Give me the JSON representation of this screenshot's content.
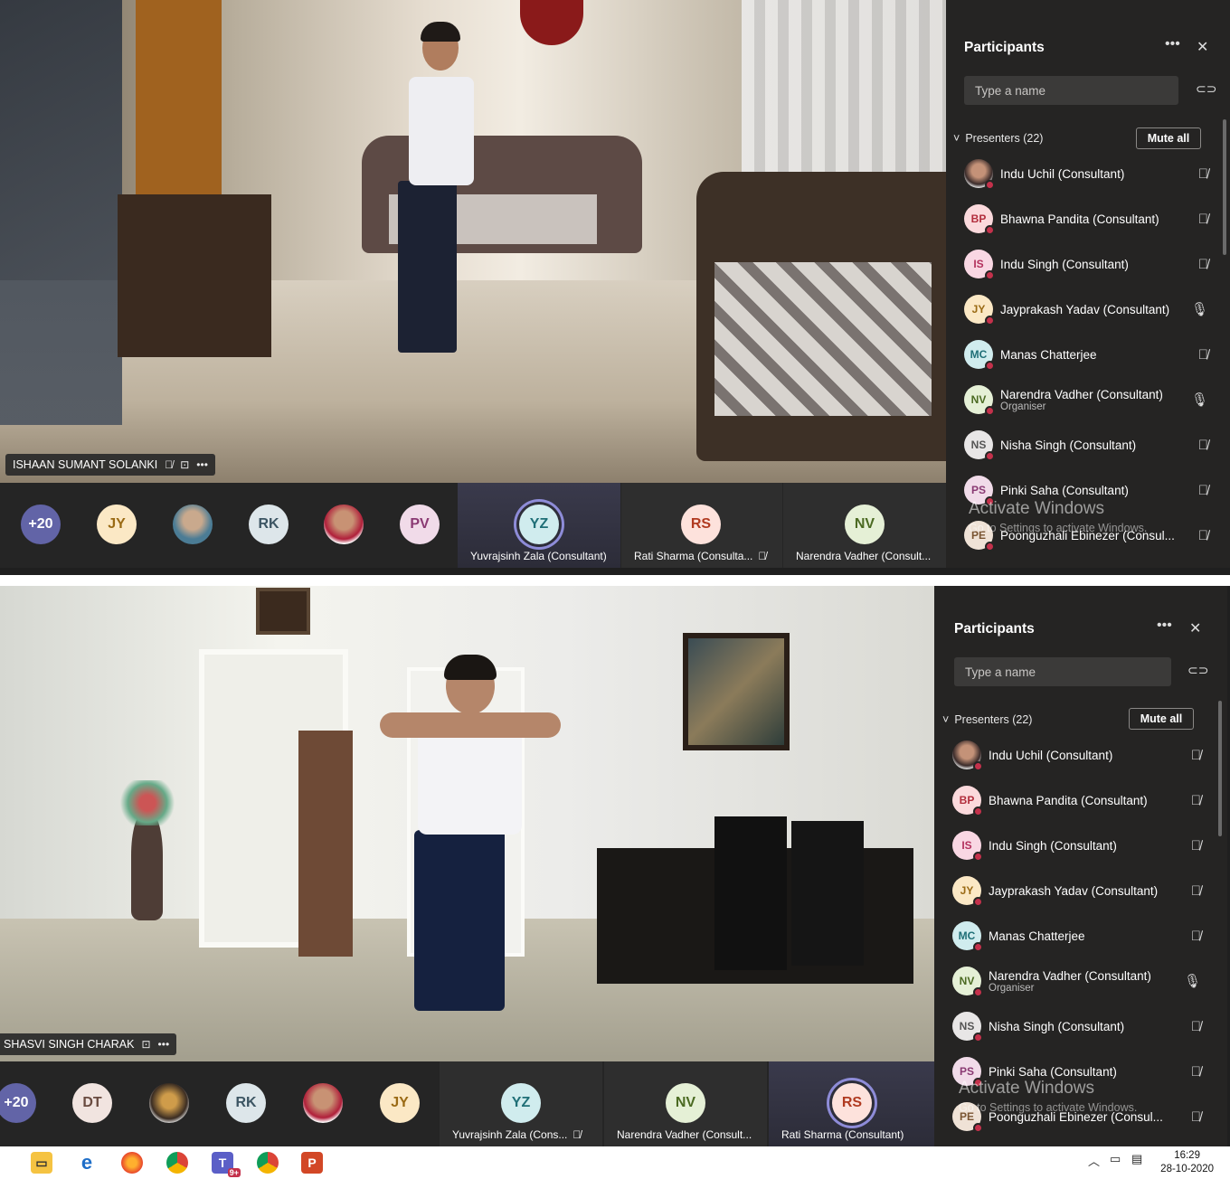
{
  "screen1": {
    "video_label": "ISHAAN SUMANT SOLANKI",
    "strip": {
      "overflow_count": "+20",
      "avatars": [
        "JY",
        "",
        "RK",
        "",
        "PV"
      ],
      "tiles": [
        {
          "initials": "YZ",
          "name": "Yuvrajsinh Zala (Consultant)"
        },
        {
          "initials": "RS",
          "name": "Rati Sharma (Consulta..."
        },
        {
          "initials": "NV",
          "name": "Narendra Vadher (Consult..."
        }
      ]
    },
    "panel": {
      "title": "Participants",
      "search_placeholder": "Type a name",
      "section": "Presenters (22)",
      "mute_all": "Mute all",
      "participants": [
        {
          "initials": "",
          "name": "Indu Uchil (Consultant)",
          "role": "",
          "mic": "muted"
        },
        {
          "initials": "BP",
          "name": "Bhawna Pandita (Consultant)",
          "role": "",
          "mic": "muted"
        },
        {
          "initials": "IS",
          "name": "Indu Singh (Consultant)",
          "role": "",
          "mic": "muted"
        },
        {
          "initials": "JY",
          "name": "Jayprakash Yadav (Consultant)",
          "role": "",
          "mic": "on"
        },
        {
          "initials": "MC",
          "name": "Manas Chatterjee",
          "role": "",
          "mic": "muted"
        },
        {
          "initials": "NV",
          "name": "Narendra Vadher (Consultant)",
          "role": "Organiser",
          "mic": "on"
        },
        {
          "initials": "NS",
          "name": "Nisha Singh (Consultant)",
          "role": "",
          "mic": "muted"
        },
        {
          "initials": "PS",
          "name": "Pinki Saha (Consultant)",
          "role": "",
          "mic": "muted"
        },
        {
          "initials": "PE",
          "name": "Poonguzhali Ebinezer (Consul...",
          "role": "",
          "mic": "muted"
        }
      ]
    }
  },
  "screen2": {
    "video_label": "SHASVI SINGH CHARAK",
    "strip": {
      "overflow_count": "+20",
      "avatars": [
        "DT",
        "",
        "RK",
        "",
        "JY"
      ],
      "tiles": [
        {
          "initials": "YZ",
          "name": "Yuvrajsinh Zala (Cons..."
        },
        {
          "initials": "NV",
          "name": "Narendra Vadher (Consult..."
        },
        {
          "initials": "RS",
          "name": "Rati Sharma (Consultant)"
        }
      ]
    },
    "panel": {
      "title": "Participants",
      "search_placeholder": "Type a name",
      "section": "Presenters (22)",
      "mute_all": "Mute all",
      "participants": [
        {
          "initials": "",
          "name": "Indu Uchil (Consultant)",
          "role": "",
          "mic": "muted"
        },
        {
          "initials": "BP",
          "name": "Bhawna Pandita (Consultant)",
          "role": "",
          "mic": "muted"
        },
        {
          "initials": "IS",
          "name": "Indu Singh (Consultant)",
          "role": "",
          "mic": "muted"
        },
        {
          "initials": "JY",
          "name": "Jayprakash Yadav (Consultant)",
          "role": "",
          "mic": "muted"
        },
        {
          "initials": "MC",
          "name": "Manas Chatterjee",
          "role": "",
          "mic": "muted"
        },
        {
          "initials": "NV",
          "name": "Narendra Vadher (Consultant)",
          "role": "Organiser",
          "mic": "on"
        },
        {
          "initials": "NS",
          "name": "Nisha Singh (Consultant)",
          "role": "",
          "mic": "muted"
        },
        {
          "initials": "PS",
          "name": "Pinki Saha (Consultant)",
          "role": "",
          "mic": "muted"
        },
        {
          "initials": "PE",
          "name": "Poonguzhali Ebinezer (Consul...",
          "role": "",
          "mic": "muted"
        }
      ]
    }
  },
  "watermark": {
    "title": "Activate Windows",
    "subtitle": "Go to Settings to activate Windows."
  },
  "taskbar": {
    "teams_badge": "9+",
    "time": "16:29",
    "date": "28-10-2020"
  },
  "colors": {
    "accent": "#8e8cd8",
    "mic_off_dot": "#c4314b",
    "panel_bg": "#252423"
  }
}
